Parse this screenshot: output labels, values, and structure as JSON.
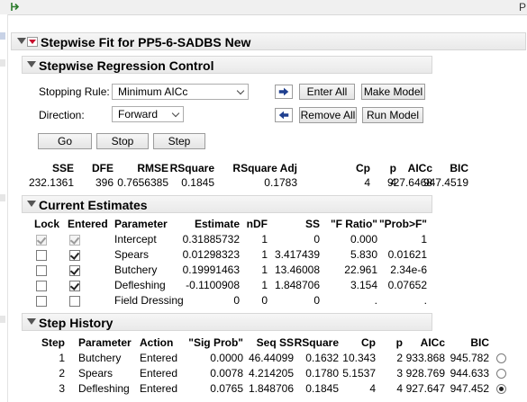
{
  "topbar": {
    "right_letter": "P"
  },
  "report": {
    "title": "Stepwise Fit for PP5-6-SADBS New"
  },
  "control": {
    "title": "Stepwise Regression Control",
    "stopping_rule_label": "Stopping Rule:",
    "stopping_rule_value": "Minimum AICc",
    "direction_label": "Direction:",
    "direction_value": "Forward",
    "enter_all": "Enter All",
    "make_model": "Make Model",
    "remove_all": "Remove All",
    "run_model": "Run Model",
    "go": "Go",
    "stop": "Stop",
    "step": "Step"
  },
  "summary": {
    "headers": [
      "SSE",
      "DFE",
      "RMSE",
      "RSquare",
      "RSquare Adj",
      "Cp",
      "p",
      "AICc",
      "BIC"
    ],
    "values": [
      "232.1361",
      "396",
      "0.7656385",
      "0.1845",
      "0.1783",
      "4",
      "4",
      "927.6468",
      "947.4519"
    ]
  },
  "current_estimates": {
    "title": "Current Estimates",
    "headers": [
      "Lock",
      "Entered",
      "Parameter",
      "Estimate",
      "nDF",
      "SS",
      "\"F Ratio\"",
      "\"Prob>F\""
    ],
    "rows": [
      {
        "lock": true,
        "lock_disabled": true,
        "entered": true,
        "entered_disabled": true,
        "parameter": "Intercept",
        "estimate": "0.31885732",
        "ndf": "1",
        "ss": "0",
        "f_ratio": "0.000",
        "prob_f": "1"
      },
      {
        "lock": false,
        "lock_disabled": false,
        "entered": true,
        "entered_disabled": false,
        "parameter": "Spears",
        "estimate": "0.01298323",
        "ndf": "1",
        "ss": "3.417439",
        "f_ratio": "5.830",
        "prob_f": "0.01621"
      },
      {
        "lock": false,
        "lock_disabled": false,
        "entered": true,
        "entered_disabled": false,
        "parameter": "Butchery",
        "estimate": "0.19991463",
        "ndf": "1",
        "ss": "13.46008",
        "f_ratio": "22.961",
        "prob_f": "2.34e-6"
      },
      {
        "lock": false,
        "lock_disabled": false,
        "entered": true,
        "entered_disabled": false,
        "parameter": "Defleshing",
        "estimate": "-0.1100908",
        "ndf": "1",
        "ss": "1.848706",
        "f_ratio": "3.154",
        "prob_f": "0.07652"
      },
      {
        "lock": false,
        "lock_disabled": false,
        "entered": false,
        "entered_disabled": false,
        "parameter": "Field Dressing",
        "estimate": "0",
        "ndf": "0",
        "ss": "0",
        "f_ratio": ".",
        "prob_f": "."
      }
    ]
  },
  "step_history": {
    "title": "Step History",
    "headers": [
      "Step",
      "Parameter",
      "Action",
      "\"Sig Prob\"",
      "Seq SS",
      "RSquare",
      "Cp",
      "p",
      "AICc",
      "BIC"
    ],
    "rows": [
      {
        "step": "1",
        "parameter": "Butchery",
        "action": "Entered",
        "sig_prob": "0.0000",
        "seq_ss": "46.44099",
        "rsquare": "0.1632",
        "cp": "10.343",
        "p": "2",
        "aicc": "933.868",
        "bic": "945.782",
        "selected": false
      },
      {
        "step": "2",
        "parameter": "Spears",
        "action": "Entered",
        "sig_prob": "0.0078",
        "seq_ss": "4.214205",
        "rsquare": "0.1780",
        "cp": "5.1537",
        "p": "3",
        "aicc": "928.769",
        "bic": "944.633",
        "selected": false
      },
      {
        "step": "3",
        "parameter": "Defleshing",
        "action": "Entered",
        "sig_prob": "0.0765",
        "seq_ss": "1.848706",
        "rsquare": "0.1845",
        "cp": "4",
        "p": "4",
        "aicc": "927.647",
        "bic": "947.452",
        "selected": true
      }
    ]
  },
  "colors": {
    "red_triangle": "#c8102e",
    "arrow_blue": "#1f3f8f",
    "header_bg": "#eeeeee"
  }
}
